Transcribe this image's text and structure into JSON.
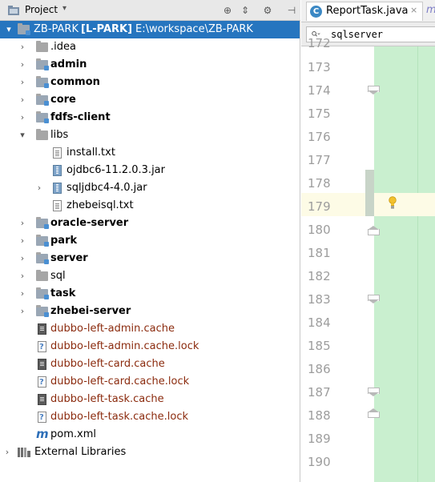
{
  "header": {
    "title": "Project",
    "caret": "▾",
    "tool_target": "⊕",
    "tool_collapse": "⇕",
    "tool_settings": "⚙",
    "tool_hide": "⊣"
  },
  "tree": {
    "root": {
      "name": "ZB-PARK",
      "module": "[L-PARK]",
      "path": "E:\\workspace\\ZB-PARK"
    },
    "items": [
      {
        "label": ".idea",
        "kind": "folder"
      },
      {
        "label": "admin",
        "kind": "module-folder"
      },
      {
        "label": "common",
        "kind": "module-folder"
      },
      {
        "label": "core",
        "kind": "module-folder"
      },
      {
        "label": "fdfs-client",
        "kind": "module-folder"
      },
      {
        "label": "libs",
        "kind": "folder"
      },
      {
        "label": "install.txt",
        "kind": "text-file"
      },
      {
        "label": "ojdbc6-11.2.0.3.jar",
        "kind": "jar-file"
      },
      {
        "label": "sqljdbc4-4.0.jar",
        "kind": "jar-file"
      },
      {
        "label": "zhebeisql.txt",
        "kind": "text-file"
      },
      {
        "label": "oracle-server",
        "kind": "module-folder"
      },
      {
        "label": "park",
        "kind": "module-folder"
      },
      {
        "label": "server",
        "kind": "module-folder"
      },
      {
        "label": "sql",
        "kind": "folder"
      },
      {
        "label": "task",
        "kind": "module-folder"
      },
      {
        "label": "zhebei-server",
        "kind": "module-folder"
      },
      {
        "label": "dubbo-left-admin.cache",
        "kind": "cache-file"
      },
      {
        "label": "dubbo-left-admin.cache.lock",
        "kind": "unknown-file"
      },
      {
        "label": "dubbo-left-card.cache",
        "kind": "cache-file"
      },
      {
        "label": "dubbo-left-card.cache.lock",
        "kind": "unknown-file"
      },
      {
        "label": "dubbo-left-task.cache",
        "kind": "cache-file"
      },
      {
        "label": "dubbo-left-task.cache.lock",
        "kind": "unknown-file"
      },
      {
        "label": "pom.xml",
        "kind": "maven-file"
      },
      {
        "label": "External Libraries",
        "kind": "libraries"
      }
    ]
  },
  "editor": {
    "tab_label": "ReportTask.java",
    "tab_icon_letter": "C",
    "tab_close": "×",
    "next_tab_icon": "m",
    "search_value": "sqlserver",
    "line_numbers": [
      "172",
      "173",
      "174",
      "175",
      "176",
      "177",
      "178",
      "179",
      "180",
      "181",
      "182",
      "183",
      "184",
      "185",
      "186",
      "187",
      "188",
      "189",
      "190"
    ],
    "current_line": "179"
  },
  "colors": {
    "selection": "#2675bf",
    "changed_lines": "#c9efcf",
    "caret_row": "#fdfbe6",
    "excluded_file_text": "#8b2b0e"
  }
}
